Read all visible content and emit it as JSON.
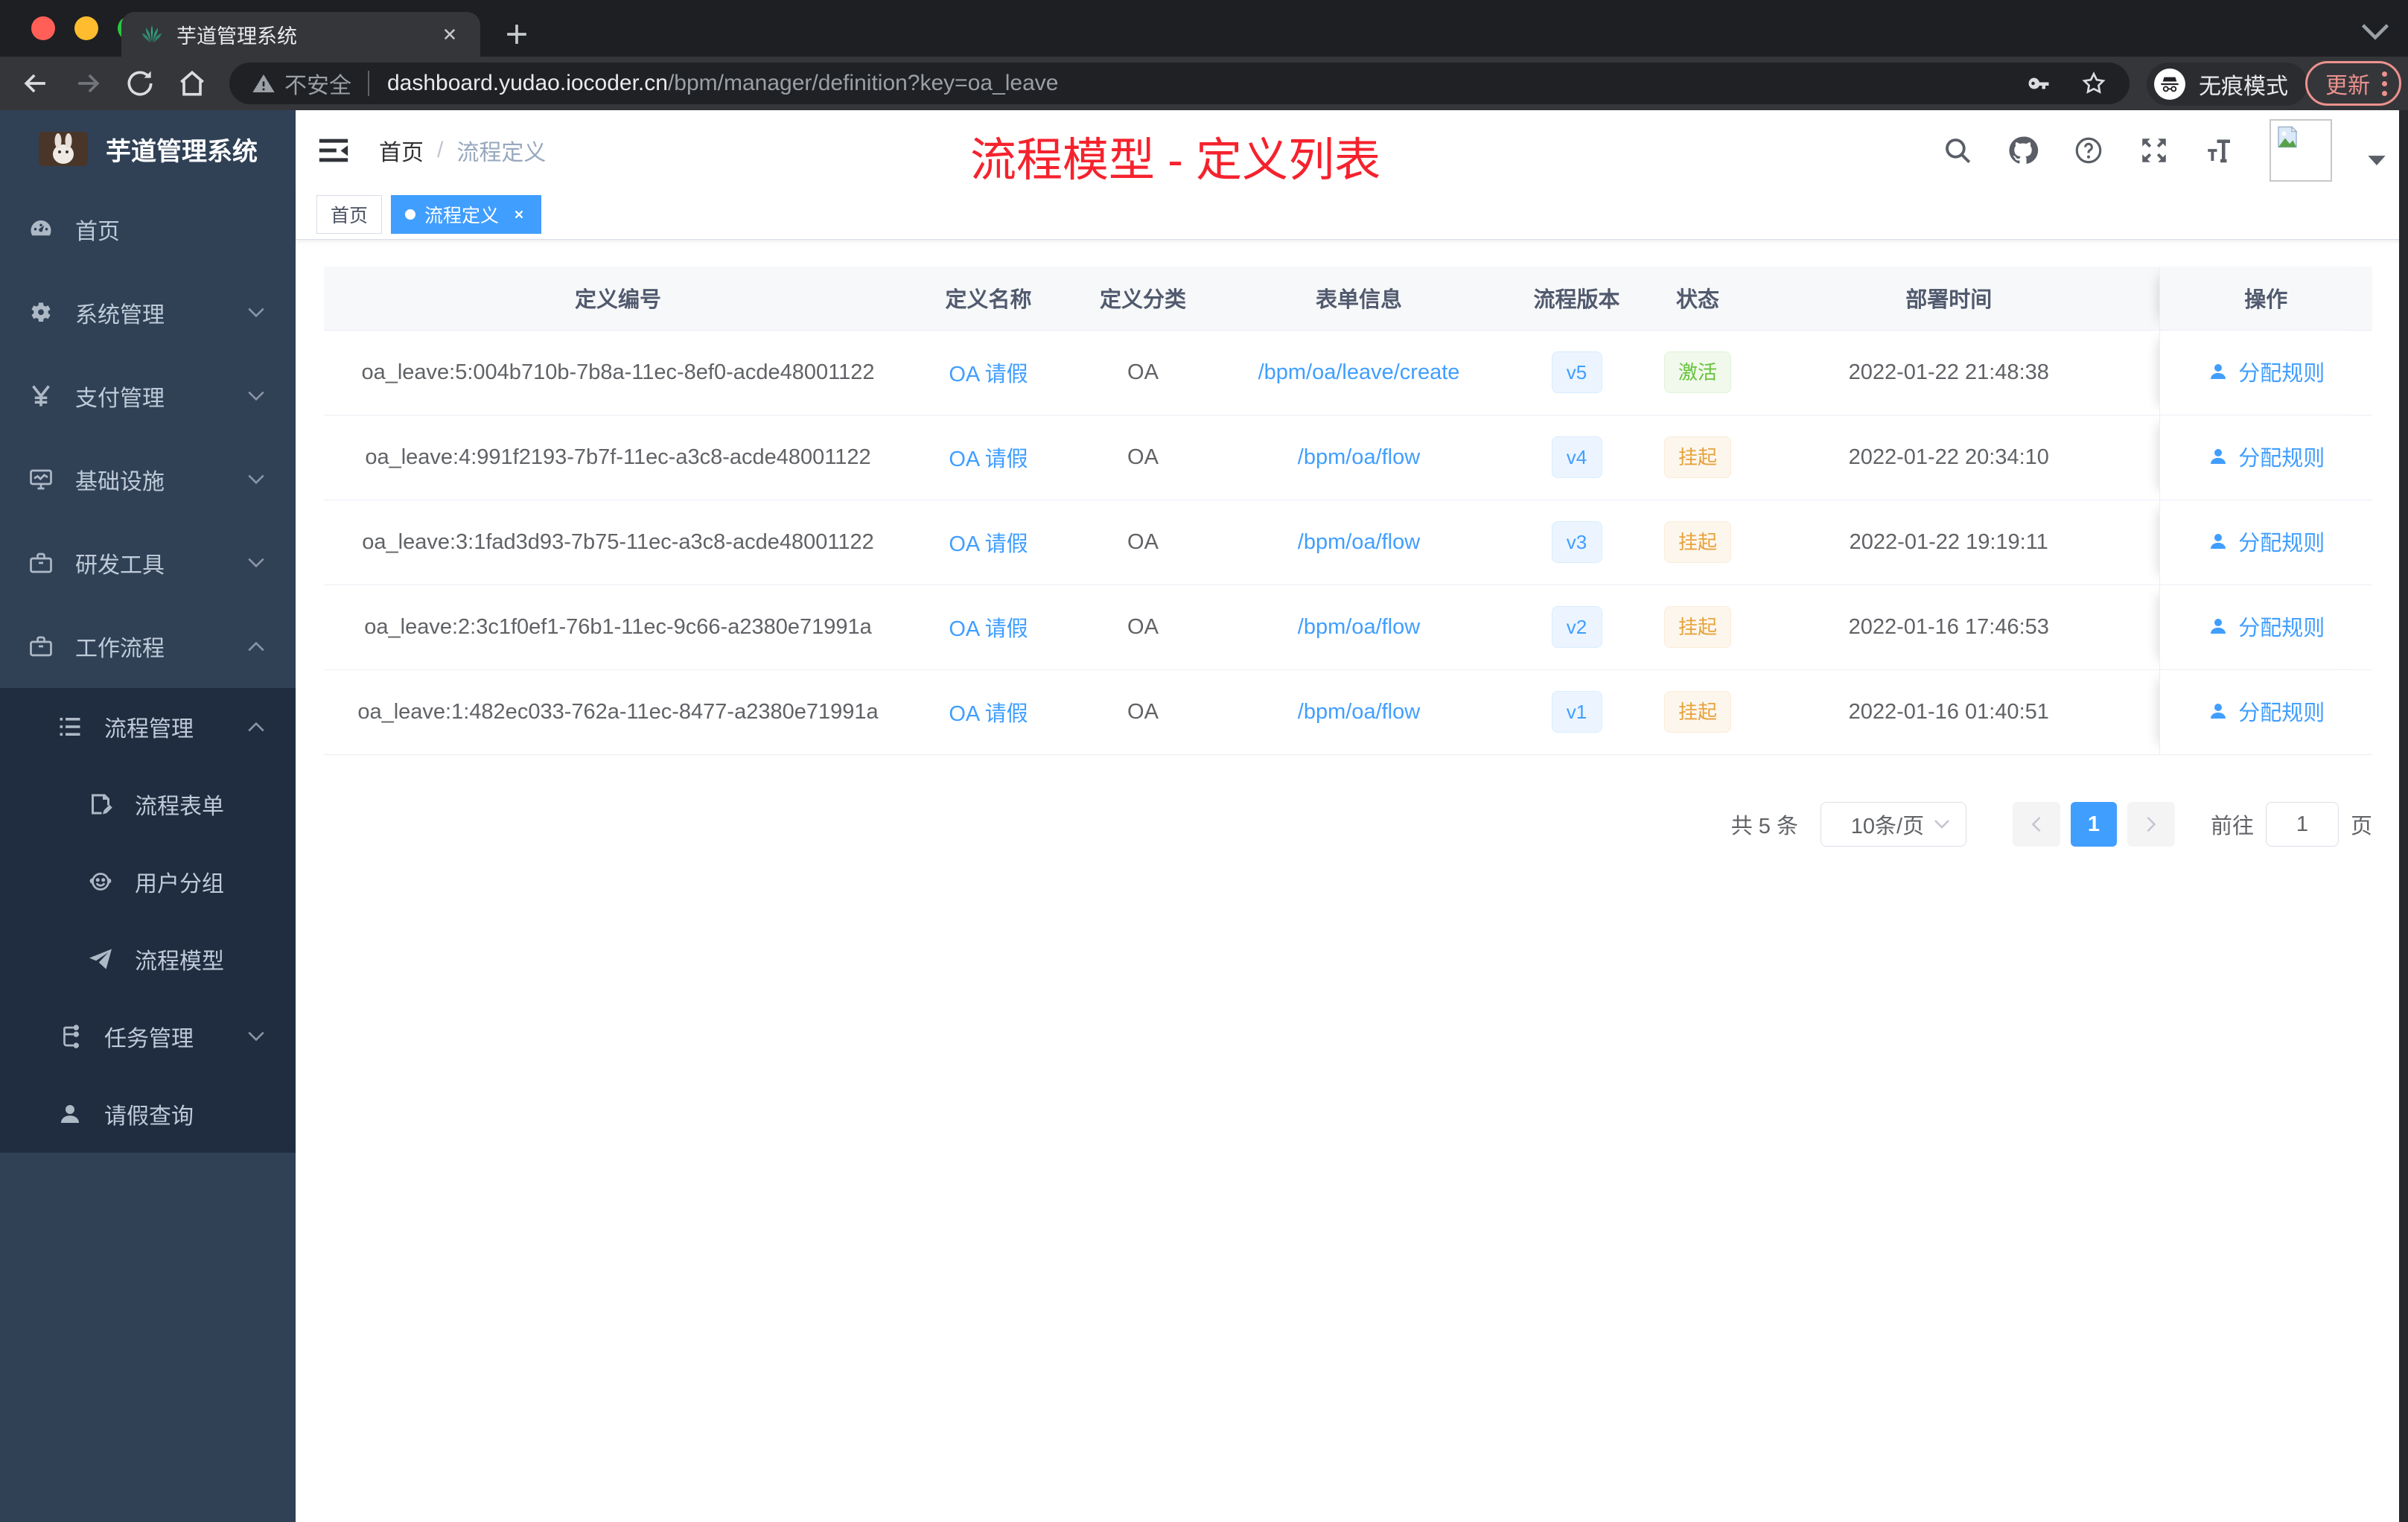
{
  "colors": {
    "accent": "#409eff",
    "success": "#67c23a",
    "warning": "#e6a23c",
    "annotation_red": "#f5222d",
    "sidebar_bg": "#304156",
    "submenu_bg": "#202c3f"
  },
  "browser": {
    "tab_title": "芋道管理系统",
    "security_label": "不安全",
    "url_domain": "dashboard.yudao.iocoder.cn",
    "url_path": "/bpm/manager/definition?key=oa_leave",
    "incognito_label": "无痕模式",
    "update_label": "更新"
  },
  "sidebar": {
    "brand": "芋道管理系统",
    "items": [
      {
        "label": "首页"
      },
      {
        "label": "系统管理"
      },
      {
        "label": "支付管理"
      },
      {
        "label": "基础设施"
      },
      {
        "label": "研发工具"
      },
      {
        "label": "工作流程"
      }
    ],
    "submenu": [
      {
        "label": "流程管理"
      },
      {
        "label": "流程表单"
      },
      {
        "label": "用户分组"
      },
      {
        "label": "流程模型"
      },
      {
        "label": "任务管理"
      },
      {
        "label": "请假查询"
      }
    ]
  },
  "header": {
    "breadcrumb": [
      "首页",
      "流程定义"
    ],
    "breadcrumb_sep": "/",
    "annotation": "流程模型 - 定义列表"
  },
  "tags": [
    {
      "label": "首页"
    },
    {
      "label": "流程定义"
    }
  ],
  "table": {
    "columns": [
      "定义编号",
      "定义名称",
      "定义分类",
      "表单信息",
      "流程版本",
      "状态",
      "部署时间",
      "操作"
    ],
    "rows": [
      {
        "id": "oa_leave:5:004b710b-7b8a-11ec-8ef0-acde48001122",
        "name": "OA 请假",
        "category": "OA",
        "form": "/bpm/oa/leave/create",
        "version": "v5",
        "status": "激活",
        "status_type": "active",
        "deployed": "2022-01-22 21:48:38",
        "action": "分配规则"
      },
      {
        "id": "oa_leave:4:991f2193-7b7f-11ec-a3c8-acde48001122",
        "name": "OA 请假",
        "category": "OA",
        "form": "/bpm/oa/flow",
        "version": "v4",
        "status": "挂起",
        "status_type": "suspend",
        "deployed": "2022-01-22 20:34:10",
        "action": "分配规则"
      },
      {
        "id": "oa_leave:3:1fad3d93-7b75-11ec-a3c8-acde48001122",
        "name": "OA 请假",
        "category": "OA",
        "form": "/bpm/oa/flow",
        "version": "v3",
        "status": "挂起",
        "status_type": "suspend",
        "deployed": "2022-01-22 19:19:11",
        "action": "分配规则"
      },
      {
        "id": "oa_leave:2:3c1f0ef1-76b1-11ec-9c66-a2380e71991a",
        "name": "OA 请假",
        "category": "OA",
        "form": "/bpm/oa/flow",
        "version": "v2",
        "status": "挂起",
        "status_type": "suspend",
        "deployed": "2022-01-16 17:46:53",
        "action": "分配规则"
      },
      {
        "id": "oa_leave:1:482ec033-762a-11ec-8477-a2380e71991a",
        "name": "OA 请假",
        "category": "OA",
        "form": "/bpm/oa/flow",
        "version": "v1",
        "status": "挂起",
        "status_type": "suspend",
        "deployed": "2022-01-16 01:40:51",
        "action": "分配规则"
      }
    ]
  },
  "pagination": {
    "total": "共 5 条",
    "page_size": "10条/页",
    "page": "1",
    "goto": "前往",
    "goto_value": "1",
    "unit": "页"
  }
}
